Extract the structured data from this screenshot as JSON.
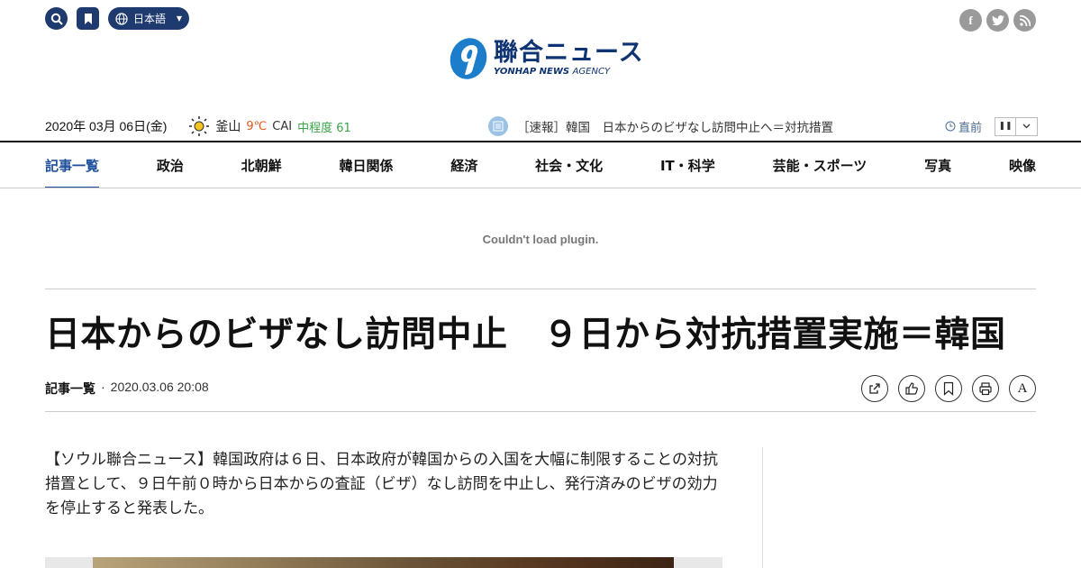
{
  "header": {
    "language_label": "日本語",
    "social": [
      "f",
      "t",
      "rss"
    ],
    "logo": {
      "jp": "聯合ニュース",
      "en_bold": "YONHAP NEWS",
      "en_light": "AGENCY"
    }
  },
  "info": {
    "date": "2020年 03月 06日(金)",
    "city": "釜山",
    "temp": "9℃",
    "cai_label": "CAI",
    "cai_value": "中程度 61",
    "ticker": "［速報］韓国　日本からのビザなし訪問中止へ＝対抗措置",
    "prev_label": "直前"
  },
  "nav": {
    "items": [
      "記事一覧",
      "政治",
      "北朝鮮",
      "韓日関係",
      "経済",
      "社会・文化",
      "IT・科学",
      "芸能・スポーツ",
      "写真",
      "映像"
    ],
    "active_index": 0
  },
  "plugin_message": "Couldn't load plugin.",
  "article": {
    "title": "日本からのビザなし訪問中止　９日から対抗措置実施＝韓国",
    "category": "記事一覧",
    "separator": "·",
    "datetime": "2020.03.06 20:08",
    "body": "【ソウル聯合ニュース】韓国政府は６日、日本政府が韓国からの入国を大幅に制限することの対抗措置として、９日午前０時から日本からの査証（ビザ）なし訪問を中止し、発行済みのビザの効力を停止すると発表した。",
    "tools": [
      "share-icon",
      "like-icon",
      "bookmark-icon",
      "print-icon",
      "font-size-icon"
    ],
    "font_tool_label": "A"
  },
  "colors": {
    "brand": "#1e3a6e",
    "active_nav": "#1e4f9b",
    "temp": "#e05a1c",
    "cai": "#3aa64a"
  }
}
